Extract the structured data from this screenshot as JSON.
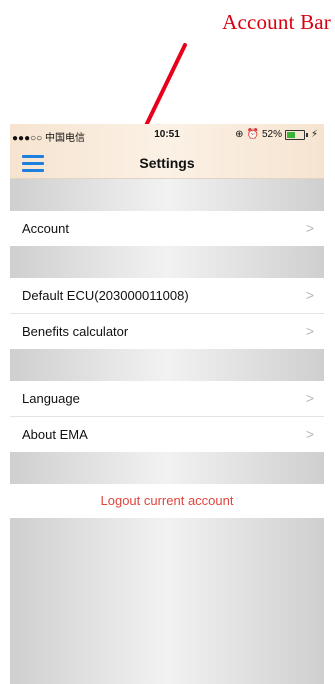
{
  "annotation": {
    "label": "Account Bar",
    "color": "#d8000f"
  },
  "status_bar": {
    "carrier": "●●●○○ 中国电信",
    "time": "10:51",
    "battery_text": "52%",
    "battery_level": 0.52
  },
  "header": {
    "title": "Settings",
    "menu_icon": "hamburger-menu-icon"
  },
  "groups": [
    [
      {
        "label": "Account"
      }
    ],
    [
      {
        "label": "Default ECU(203000011008)"
      },
      {
        "label": "Benefits calculator"
      }
    ],
    [
      {
        "label": "Language"
      },
      {
        "label": "About EMA"
      }
    ]
  ],
  "chevron": ">",
  "logout": {
    "label": "Logout current account",
    "color": "#e0443c"
  },
  "colors": {
    "accent": "#1f7fe0",
    "header_bg": "#f6e4d0"
  }
}
